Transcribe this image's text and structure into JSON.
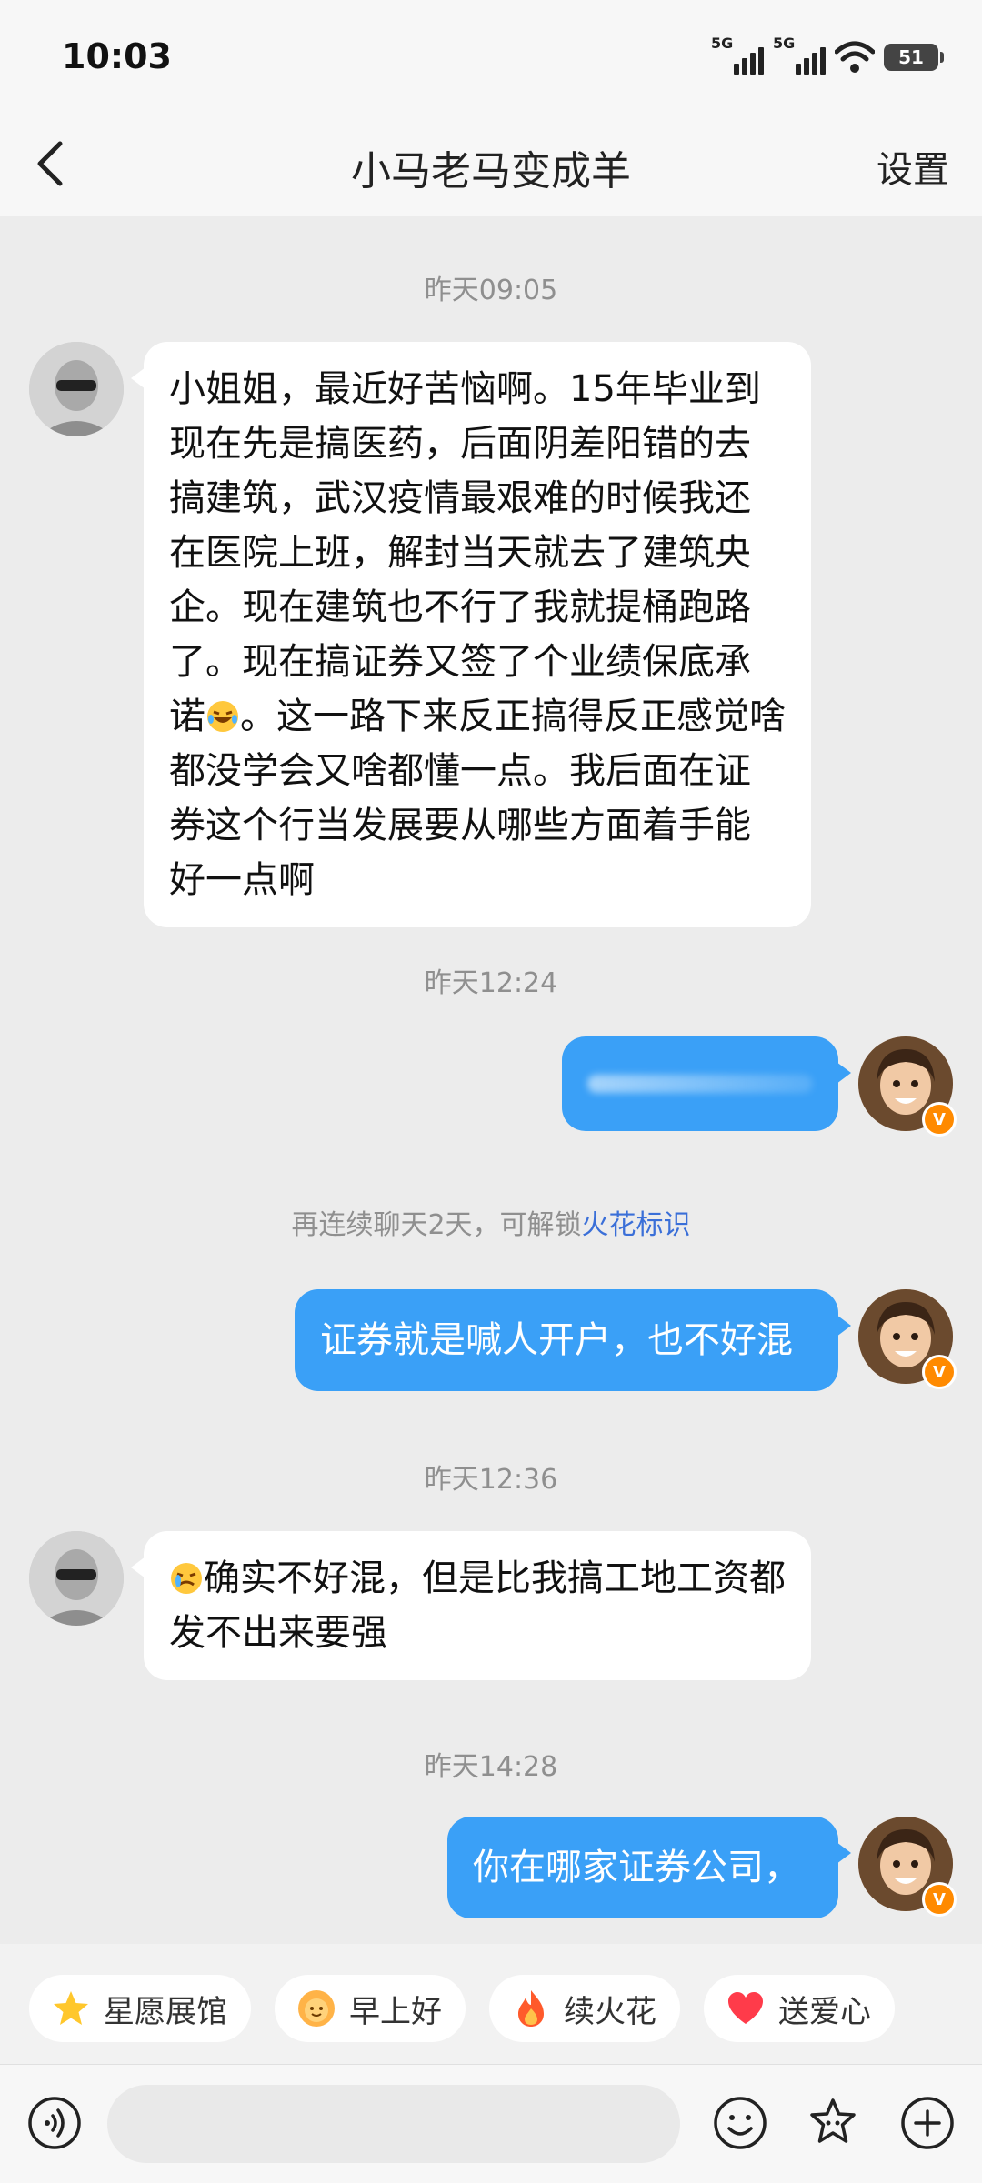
{
  "status": {
    "time": "10:03",
    "net1": "5G",
    "net2": "5G",
    "battery": "51"
  },
  "header": {
    "title": "小马老马变成羊",
    "settings": "设置"
  },
  "messages": {
    "ts1": "昨天09:05",
    "m1": "小姐姐，最近好苦恼啊。15年毕业到现在先是搞医药，后面阴差阳错的去搞建筑，武汉疫情最艰难的时候我还在医院上班，解封当天就去了建筑央企。现在建筑也不行了我就提桶跑路了。现在搞证券又签了个业绩保底承诺",
    "m1b": "。这一路下来反正搞得反正感觉啥都没学会又啥都懂一点。我后面在证券这个行当发展要从哪些方面着手能好一点啊",
    "ts2": "昨天12:24",
    "hint_pre": "再连续聊天2天，可解锁",
    "hint_link": "火花标识",
    "m3": "证券就是喊人开户，也不好混",
    "ts3": "昨天12:36",
    "m4": "确实不好混，但是比我搞工地工资都发不出来要强",
    "ts4": "昨天14:28",
    "m5": "你在哪家证券公司，"
  },
  "chips": [
    {
      "label": "星愿展馆",
      "icon": "star-icon"
    },
    {
      "label": "早上好",
      "icon": "sun-face-icon"
    },
    {
      "label": "续火花",
      "icon": "fire-icon"
    },
    {
      "label": "送爱心",
      "icon": "heart-icon"
    }
  ],
  "colors": {
    "bubble_out": "#3aa0f7",
    "bubble_in": "#ffffff",
    "link": "#3a6fd8"
  }
}
